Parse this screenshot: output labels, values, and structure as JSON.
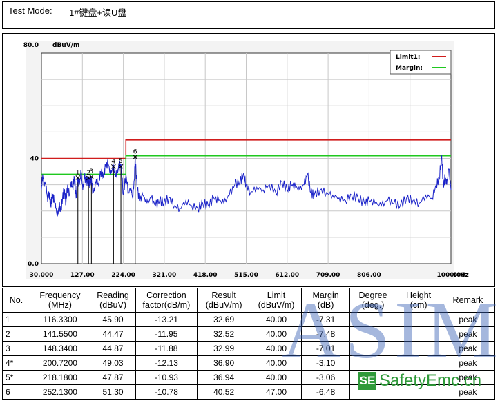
{
  "test_mode": {
    "label": "Test Mode:",
    "value": "1#键盘+读U盘"
  },
  "chart_data": {
    "type": "line",
    "title": "",
    "ylabel": "dBuV/m",
    "xlabel": "MHz",
    "ylim": [
      0,
      80
    ],
    "xlim": [
      30,
      1000
    ],
    "y_ticks": [
      "80.0",
      "40",
      "0.0"
    ],
    "x_ticks": [
      "30.000",
      "127.00",
      "224.00",
      "321.00",
      "418.00",
      "515.00",
      "612.00",
      "709.00",
      "806.00",
      "1000.00"
    ],
    "grid": true,
    "legend_position": "top-right",
    "legend": [
      {
        "name": "Limit1:",
        "color": "#d01c1c"
      },
      {
        "name": "Margin:",
        "color": "#1fc81f"
      }
    ],
    "limit_line": {
      "x": [
        30,
        230,
        230,
        1000
      ],
      "y": [
        40,
        40,
        47,
        47
      ]
    },
    "margin_line": {
      "x": [
        30,
        230,
        230,
        1000
      ],
      "y": [
        34,
        34,
        41,
        41
      ]
    },
    "markers": [
      {
        "label": "1",
        "x": 116.33,
        "y": 32.69
      },
      {
        "label": "2",
        "x": 141.55,
        "y": 32.52
      },
      {
        "label": "3",
        "x": 148.34,
        "y": 32.99
      },
      {
        "label": "4",
        "x": 200.72,
        "y": 36.9
      },
      {
        "label": "5",
        "x": 218.18,
        "y": 36.94
      },
      {
        "label": "6",
        "x": 252.13,
        "y": 40.52
      }
    ],
    "trace": {
      "color": "#1a22c8",
      "x": [
        30,
        33,
        36,
        40,
        44,
        48,
        52,
        56,
        60,
        64,
        68,
        72,
        76,
        80,
        84,
        88,
        92,
        96,
        100,
        104,
        108,
        112,
        116,
        120,
        124,
        128,
        132,
        136,
        141,
        145,
        148,
        152,
        156,
        160,
        165,
        170,
        176,
        182,
        188,
        194,
        200,
        206,
        212,
        218,
        224,
        230,
        236,
        242,
        246,
        250,
        252,
        256,
        262,
        270,
        280,
        290,
        300,
        310,
        320,
        332,
        345,
        358,
        372,
        386,
        400,
        412,
        425,
        438,
        450,
        462,
        475,
        488,
        500,
        508,
        515,
        525,
        540,
        555,
        570,
        585,
        600,
        612,
        622,
        632,
        642,
        652,
        660,
        668,
        676,
        690,
        705,
        720,
        735,
        750,
        765,
        780,
        795,
        806,
        820,
        835,
        850,
        865,
        880,
        895,
        910,
        925,
        940,
        955,
        965,
        972,
        978,
        982,
        986,
        990,
        995,
        1000
      ],
      "y": [
        28,
        34,
        30,
        31,
        25,
        27,
        22,
        26,
        24,
        21,
        18,
        22,
        20,
        25,
        28,
        23,
        30,
        26,
        31,
        29,
        33,
        25,
        32,
        30,
        35,
        28,
        33,
        31,
        32,
        30,
        33,
        27,
        29,
        32,
        30,
        35,
        33,
        37,
        38,
        34,
        37,
        33,
        36,
        38,
        26,
        34,
        27,
        29,
        25,
        32,
        40,
        30,
        24,
        26,
        23,
        25,
        22,
        24,
        23,
        25,
        22,
        21,
        24,
        22,
        21,
        23,
        22,
        25,
        24,
        23,
        26,
        30,
        31,
        34,
        30,
        27,
        29,
        28,
        30,
        27,
        31,
        28,
        30,
        29,
        28,
        30,
        34,
        27,
        26,
        28,
        27,
        26,
        25,
        24,
        26,
        25,
        23,
        24,
        23,
        22,
        24,
        23,
        22,
        25,
        24,
        23,
        26,
        25,
        30,
        32,
        41,
        29,
        33,
        30,
        36,
        28
      ]
    }
  },
  "table": {
    "headers": [
      {
        "l1": "No.",
        "l2": ""
      },
      {
        "l1": "Frequency",
        "l2": "(MHz)"
      },
      {
        "l1": "Reading",
        "l2": "(dBuV)"
      },
      {
        "l1": "Correction",
        "l2": "factor(dB/m)"
      },
      {
        "l1": "Result",
        "l2": "(dBuV/m)"
      },
      {
        "l1": "Limit",
        "l2": "(dBuV/m)"
      },
      {
        "l1": "Margin",
        "l2": "(dB)"
      },
      {
        "l1": "Degree",
        "l2": "(deg.)"
      },
      {
        "l1": "Height",
        "l2": "(cm)"
      },
      {
        "l1": "Remark",
        "l2": ""
      }
    ],
    "rows": [
      {
        "no": "1",
        "freq": "116.3300",
        "reading": "45.90",
        "corr": "-13.21",
        "result": "32.69",
        "limit": "40.00",
        "margin": "-7.31",
        "degree": "",
        "height": "",
        "remark": "peak"
      },
      {
        "no": "2",
        "freq": "141.5500",
        "reading": "44.47",
        "corr": "-11.95",
        "result": "32.52",
        "limit": "40.00",
        "margin": "-7.48",
        "degree": "",
        "height": "",
        "remark": "peak"
      },
      {
        "no": "3",
        "freq": "148.3400",
        "reading": "44.87",
        "corr": "-11.88",
        "result": "32.99",
        "limit": "40.00",
        "margin": "-7.01",
        "degree": "",
        "height": "",
        "remark": "peak"
      },
      {
        "no": "4*",
        "freq": "200.7200",
        "reading": "49.03",
        "corr": "-12.13",
        "result": "36.90",
        "limit": "40.00",
        "margin": "-3.10",
        "degree": "",
        "height": "",
        "remark": "peak"
      },
      {
        "no": "5*",
        "freq": "218.1800",
        "reading": "47.87",
        "corr": "-10.93",
        "result": "36.94",
        "limit": "40.00",
        "margin": "-3.06",
        "degree": "",
        "height": "",
        "remark": "peak"
      },
      {
        "no": "6",
        "freq": "252.1300",
        "reading": "51.30",
        "corr": "-10.78",
        "result": "40.52",
        "limit": "47.00",
        "margin": "-6.48",
        "degree": "",
        "height": "",
        "remark": "peak"
      }
    ]
  },
  "watermark": {
    "main": "ASIM",
    "badge": "SE",
    "site": "SafetyEmc.cn"
  }
}
